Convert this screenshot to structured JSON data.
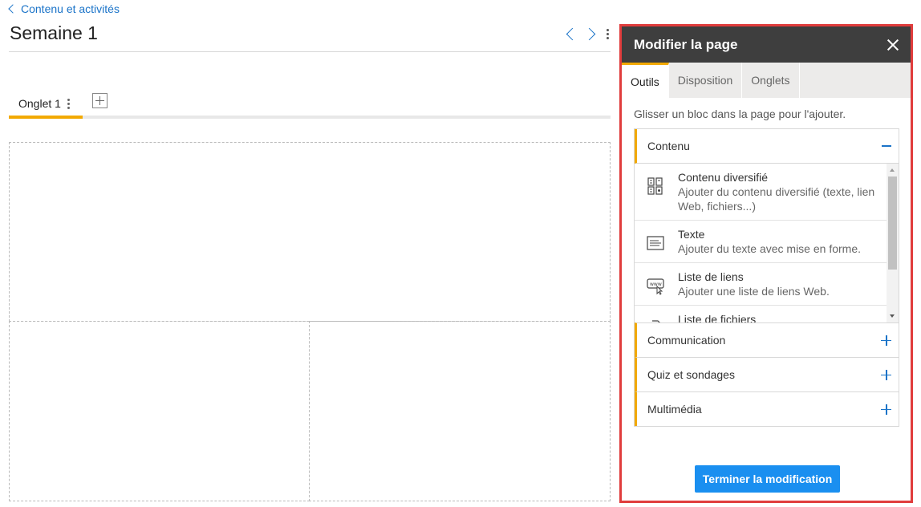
{
  "breadcrumb": {
    "label": "Contenu et activités"
  },
  "page": {
    "title": "Semaine 1"
  },
  "tabs": [
    {
      "label": "Onglet 1"
    }
  ],
  "panel": {
    "title": "Modifier la page",
    "tabs": [
      {
        "label": "Outils"
      },
      {
        "label": "Disposition"
      },
      {
        "label": "Onglets"
      }
    ],
    "hint": "Glisser un bloc dans la page pour l'ajouter.",
    "sections": [
      {
        "label": "Contenu",
        "items": [
          {
            "title": "Contenu diversifié",
            "desc": "Ajouter du contenu diversifié (texte, lien Web, fichiers...)"
          },
          {
            "title": "Texte",
            "desc": "Ajouter du texte avec mise en forme."
          },
          {
            "title": "Liste de liens",
            "desc": "Ajouter une liste de liens Web."
          },
          {
            "title": "Liste de fichiers",
            "desc": ""
          }
        ]
      },
      {
        "label": "Communication"
      },
      {
        "label": "Quiz et sondages"
      },
      {
        "label": "Multimédia"
      }
    ],
    "finish_label": "Terminer la modification"
  },
  "colors": {
    "accent": "#f2a900",
    "link": "#1a73c8",
    "header": "#3e3e3e",
    "primary_button": "#1a8ff0",
    "highlight_border": "#e03c3c"
  }
}
